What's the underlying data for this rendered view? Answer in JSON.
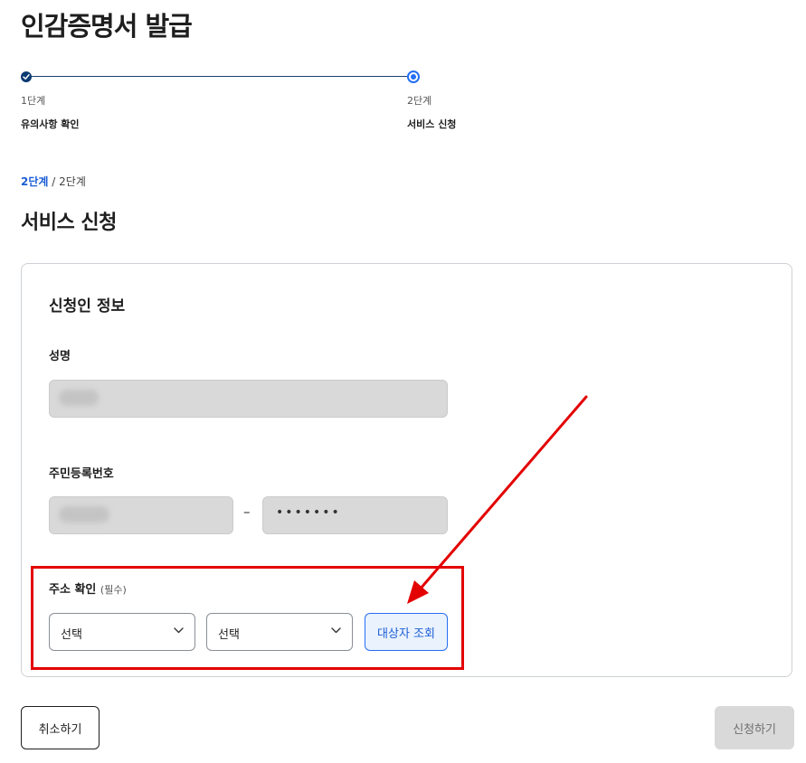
{
  "page": {
    "title": "인감증명서 발급"
  },
  "stepper": {
    "steps": [
      {
        "number": "1단계",
        "name": "유의사항 확인",
        "state": "done"
      },
      {
        "number": "2단계",
        "name": "서비스 신청",
        "state": "current"
      }
    ]
  },
  "progress": {
    "current": "2단계",
    "separator": "/",
    "total": "2단계"
  },
  "section": {
    "title": "서비스 신청"
  },
  "form": {
    "title": "신청인 정보",
    "name": {
      "label": "성명"
    },
    "rrn": {
      "label": "주민등록번호",
      "separator": "–",
      "back_masked": "•••••••"
    },
    "address": {
      "label": "주소 확인",
      "required_note": "(필수)",
      "select1": {
        "value": "선택"
      },
      "select2": {
        "value": "선택"
      },
      "lookup_label": "대상자 조회"
    }
  },
  "actions": {
    "cancel_label": "취소하기",
    "submit_label": "신청하기"
  },
  "icons": {
    "check": "check-icon",
    "chevron": "chevron-down-icon"
  },
  "colors": {
    "primary": "#256ef4",
    "navy": "#0b3a72",
    "annotation": "#e30000",
    "disabled_bg": "#d9d9d9"
  }
}
